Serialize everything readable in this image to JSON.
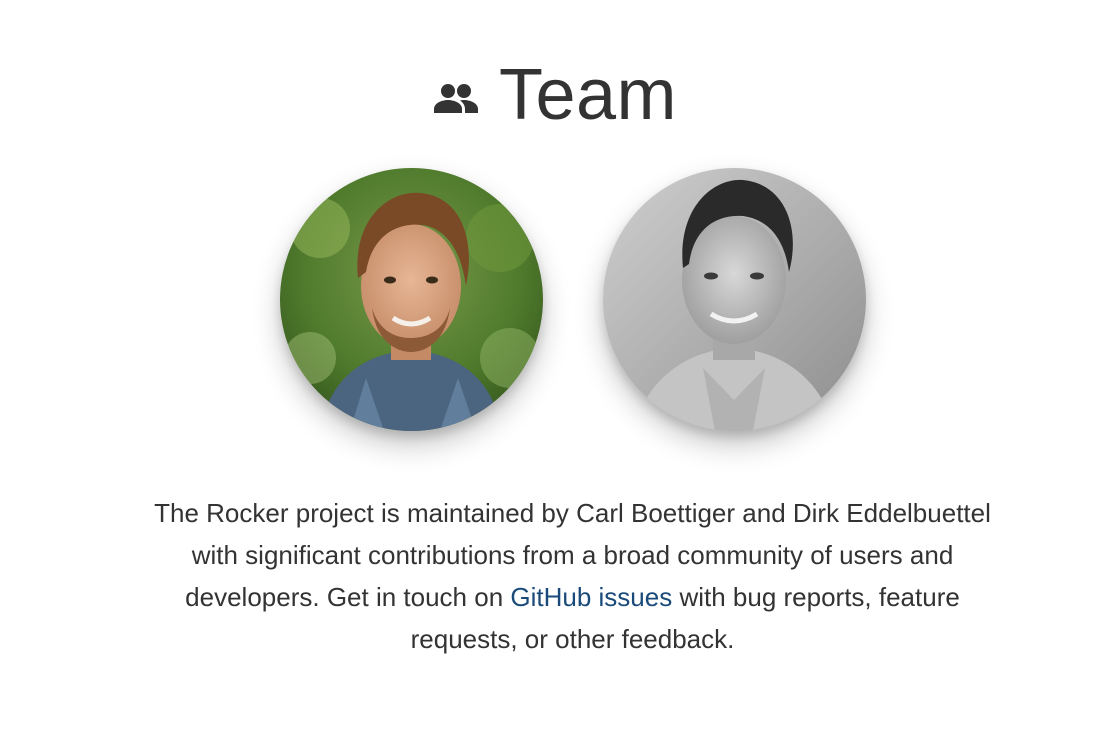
{
  "team": {
    "heading": {
      "title": "Team",
      "icon": "people-icon"
    },
    "members": [
      {
        "photo_icon": "carl-boettiger-photo",
        "photo_style": "color"
      },
      {
        "photo_icon": "dirk-eddelbuettel-photo",
        "photo_style": "grayscale"
      }
    ],
    "description": {
      "text_before_link": "The Rocker project is maintained by Carl Boettiger and Dirk Eddelbuettel with significant contributions from a broad community of users and developers. Get in touch on ",
      "link_text": "GitHub issues",
      "text_after_link": " with bug reports, feature requests, or other feedback."
    },
    "colors": {
      "text": "#333333",
      "link": "#1a4a7a",
      "background": "#ffffff"
    }
  }
}
